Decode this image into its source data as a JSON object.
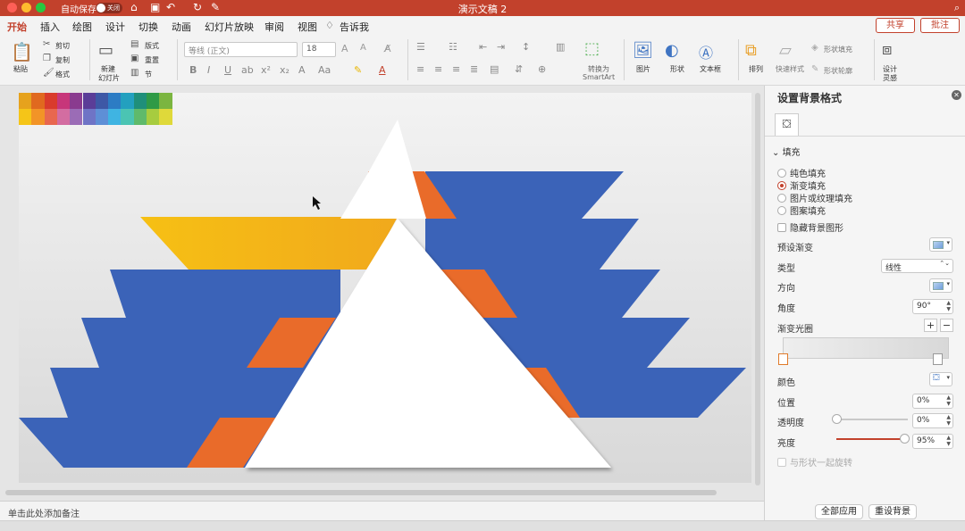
{
  "titlebar": {
    "autosave_label": "自动保存",
    "autosave_state": "关闭",
    "doc_title": "演示文稿 2",
    "color": "#c2412c"
  },
  "tabs": [
    "开始",
    "插入",
    "绘图",
    "设计",
    "切换",
    "动画",
    "幻灯片放映",
    "审阅",
    "视图"
  ],
  "tell_me": "告诉我",
  "share_label": "共享",
  "comment_label": "批注",
  "ribbon": {
    "paste": "粘贴",
    "cut": "剪切",
    "copy": "复制",
    "format": "格式",
    "new_slide_line1": "新建",
    "new_slide_line2": "幻灯片",
    "layout": "版式",
    "reset": "重置",
    "section": "节",
    "font_placeholder": "等线 (正文)",
    "font_size": "18",
    "convert_smartart_line1": "转换为",
    "convert_smartart_line2": "SmartArt",
    "picture": "图片",
    "shape": "形状",
    "textbox": "文本框",
    "arrange": "排列",
    "quick_styles": "快速样式",
    "shape_fill": "形状填充",
    "shape_outline": "形状轮廓",
    "design_ideas_line1": "设计",
    "design_ideas_line2": "灵感"
  },
  "slide": {
    "palette_row1": [
      "#e6a21d",
      "#e0691f",
      "#d93b2c",
      "#c7367a",
      "#8a3b8f",
      "#5b3d98",
      "#3e58a6",
      "#2c7cc4",
      "#23a0bf",
      "#1f8f7a",
      "#2f9a46",
      "#7bb540"
    ],
    "palette_row2": [
      "#f5c518",
      "#f29427",
      "#e8674f",
      "#d36da1",
      "#9b6cb6",
      "#6f74c6",
      "#5e8fd6",
      "#3fb4e2",
      "#4bc4b3",
      "#5fba6b",
      "#a7cc3f",
      "#dfd93a"
    ],
    "blue": "#3b63b8",
    "orange": "#e96b2a",
    "yellow": "#f6c014"
  },
  "notes_placeholder": "单击此处添加备注",
  "panel": {
    "title": "设置背景格式",
    "fill_section": "填充",
    "fill_options": [
      "纯色填充",
      "渐变填充",
      "图片或纹理填充",
      "图案填充"
    ],
    "fill_selected": "渐变填充",
    "hide_background": "隐藏背景图形",
    "preset_gradient": "预设渐变",
    "type_label": "类型",
    "type_value": "线性",
    "direction_label": "方向",
    "angle_label": "角度",
    "angle_value": "90°",
    "gradient_stops_label": "渐变光圈",
    "color_label": "颜色",
    "position_label": "位置",
    "position_value": "0%",
    "transparency_label": "透明度",
    "transparency_value": "0%",
    "transparency_level": 0,
    "brightness_label": "亮度",
    "brightness_value": "95%",
    "brightness_level": 0.95,
    "rotate_with_shape": "与形状一起旋转",
    "apply_all": "全部应用",
    "reset_background": "重设背景"
  }
}
